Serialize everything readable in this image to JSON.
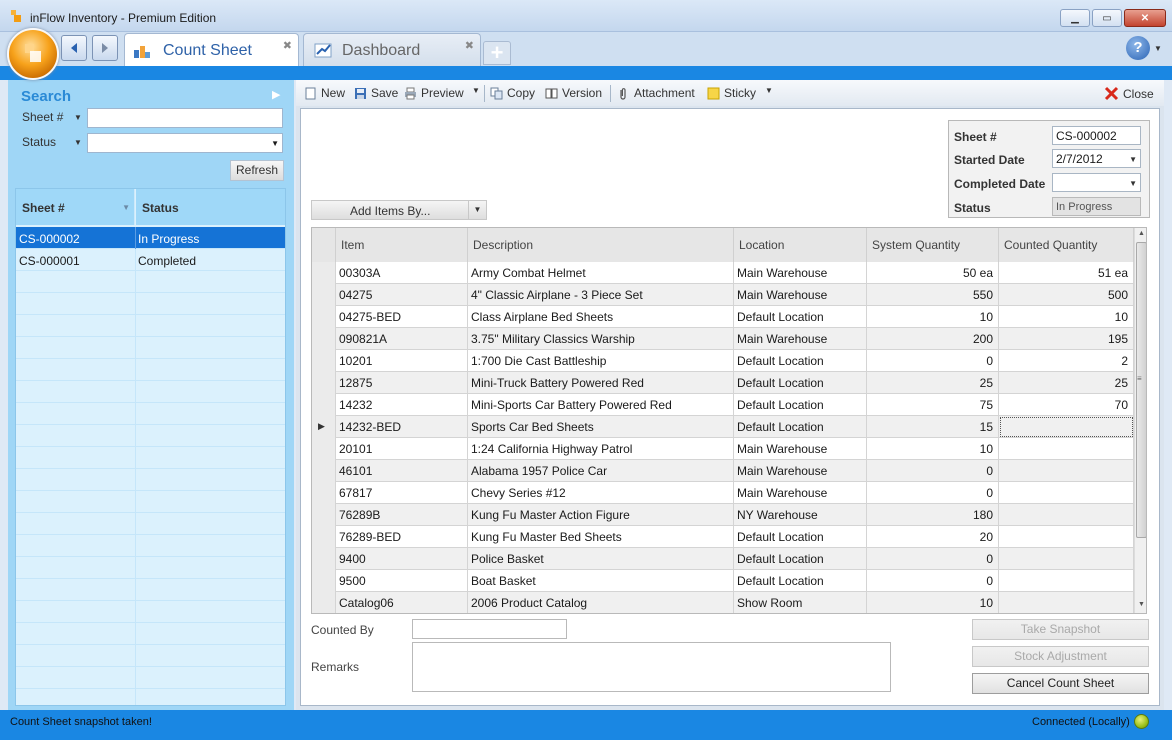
{
  "window": {
    "title": "inFlow Inventory - Premium Edition"
  },
  "tabs": [
    {
      "label": "Count Sheet",
      "active": true
    },
    {
      "label": "Dashboard",
      "active": false
    }
  ],
  "search": {
    "heading": "Search",
    "fields": [
      {
        "label": "Sheet #",
        "value": ""
      },
      {
        "label": "Status",
        "value": ""
      }
    ],
    "refresh_label": "Refresh"
  },
  "sheet_list": {
    "headers": [
      "Sheet #",
      "Status"
    ],
    "rows": [
      {
        "sheet": "CS-000002",
        "status": "In Progress",
        "selected": true
      },
      {
        "sheet": "CS-000001",
        "status": "Completed",
        "selected": false
      }
    ]
  },
  "toolbar": {
    "new": "New",
    "save": "Save",
    "preview": "Preview",
    "copy": "Copy",
    "version": "Version",
    "attachment": "Attachment",
    "sticky": "Sticky",
    "close": "Close"
  },
  "info": {
    "sheet_label": "Sheet #",
    "sheet_value": "CS-000002",
    "started_label": "Started Date",
    "started_value": "2/7/2012",
    "completed_label": "Completed Date",
    "completed_value": "",
    "status_label": "Status",
    "status_value": "In Progress"
  },
  "add_items_label": "Add Items By...",
  "grid": {
    "headers": [
      "Item",
      "Description",
      "Location",
      "System Quantity",
      "Counted Quantity"
    ],
    "rows": [
      [
        "00303A",
        "Army Combat Helmet",
        "Main Warehouse",
        "50 ea",
        "51 ea"
      ],
      [
        "04275",
        "4\" Classic Airplane - 3 Piece Set",
        "Main Warehouse",
        "550",
        "500"
      ],
      [
        "04275-BED",
        "Class Airplane Bed Sheets",
        "Default Location",
        "10",
        "10"
      ],
      [
        "090821A",
        "3.75\" Military Classics Warship",
        "Main Warehouse",
        "200",
        "195"
      ],
      [
        "10201",
        "1:700 Die Cast Battleship",
        "Default Location",
        "0",
        "2"
      ],
      [
        "12875",
        "Mini-Truck Battery Powered Red",
        "Default Location",
        "25",
        "25"
      ],
      [
        "14232",
        "Mini-Sports Car Battery Powered Red",
        "Default Location",
        "75",
        "70"
      ],
      [
        "14232-BED",
        "Sports Car Bed Sheets",
        "Default Location",
        "15",
        ""
      ],
      [
        "20101",
        "1:24 California Highway Patrol",
        "Main Warehouse",
        "10",
        ""
      ],
      [
        "46101",
        "Alabama 1957 Police Car",
        "Main Warehouse",
        "0",
        ""
      ],
      [
        "67817",
        "Chevy Series #12",
        "Main Warehouse",
        "0",
        ""
      ],
      [
        "76289B",
        "Kung Fu Master Action Figure",
        "NY Warehouse",
        "180",
        ""
      ],
      [
        "76289-BED",
        "Kung Fu Master Bed Sheets",
        "Default Location",
        "20",
        ""
      ],
      [
        "9400",
        "Police Basket",
        "Default Location",
        "0",
        ""
      ],
      [
        "9500",
        "Boat Basket",
        "Default Location",
        "0",
        ""
      ],
      [
        "Catalog06",
        "2006 Product Catalog",
        "Show Room",
        "10",
        ""
      ]
    ]
  },
  "form": {
    "counted_by_label": "Counted By",
    "counted_by_value": "",
    "remarks_label": "Remarks",
    "remarks_value": ""
  },
  "actions": {
    "take_snapshot": "Take Snapshot",
    "stock_adjustment": "Stock Adjustment",
    "cancel_count_sheet": "Cancel Count Sheet"
  },
  "status_bar": {
    "message": "Count Sheet snapshot taken!",
    "connection": "Connected (Locally)"
  },
  "colors": {
    "accent_blue": "#1a87e3",
    "selection_blue": "#1573d6",
    "panel_blue": "#9fd6f6"
  }
}
